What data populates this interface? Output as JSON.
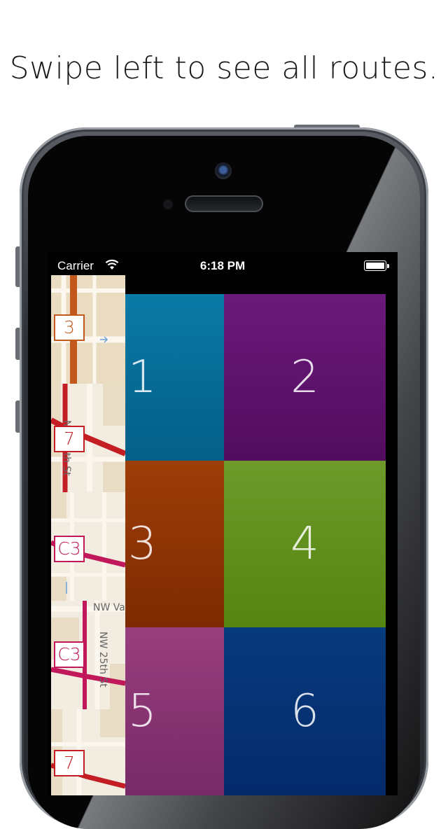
{
  "caption": "Swipe left to see all routes.",
  "status_bar": {
    "carrier": "Carrier",
    "time": "6:18 PM"
  },
  "route_strip": [
    {
      "badge": "3",
      "color": "#c2581c"
    },
    {
      "badge": "7",
      "color": "#c41e24",
      "street": "NW 25th St"
    },
    {
      "badge": "C3",
      "color": "#c0185a"
    },
    {
      "badge": "C3",
      "color": "#c0185a",
      "street": "NW 25th St",
      "street2": "NW Va"
    },
    {
      "badge": "7",
      "color": "#c41e24"
    }
  ],
  "tiles": [
    {
      "label": "1",
      "color_top": "#0a7aa6",
      "color_bottom": "#035f88"
    },
    {
      "label": "2",
      "color_top": "#6a1a7a",
      "color_bottom": "#520c5e"
    },
    {
      "label": "3",
      "color_top": "#9e3e08",
      "color_bottom": "#7e2a02"
    },
    {
      "label": "4",
      "color_top": "#6e9a2a",
      "color_bottom": "#558512"
    },
    {
      "label": "5",
      "color_top": "#9a3e7e",
      "color_bottom": "#762a66"
    },
    {
      "label": "6",
      "color_top": "#073a7e",
      "color_bottom": "#042a6a"
    }
  ]
}
